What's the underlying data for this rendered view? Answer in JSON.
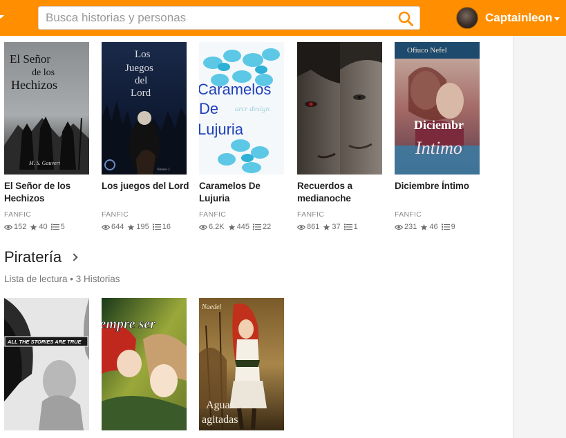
{
  "header": {
    "search_placeholder": "Busca historias y personas",
    "username": "Captainleon"
  },
  "colors": {
    "accent": "#ff8f00"
  },
  "stories": [
    {
      "title": "El Señor de los Hechizos",
      "cover_text": [
        "El Señor",
        "de los",
        "Hechizos"
      ],
      "cover_signature": "M. S. Gauvert",
      "category": "FANFIC",
      "reads": "152",
      "votes": "40",
      "parts": "5"
    },
    {
      "title": "Los juegos del Lord",
      "cover_text": [
        "Los",
        "Juegos",
        "del",
        "Lord"
      ],
      "cover_signature": "Volume 2",
      "category": "FANFIC",
      "reads": "644",
      "votes": "195",
      "parts": "16"
    },
    {
      "title": "Caramelos De Lujuria",
      "cover_text": [
        "Caramelos",
        "De",
        "Lujuria"
      ],
      "cover_watermark": "arcr design",
      "category": "FANFIC",
      "reads": "6.2K",
      "votes": "445",
      "parts": "22"
    },
    {
      "title": "Recuerdos a medianoche",
      "category": "FANFIC",
      "reads": "861",
      "votes": "37",
      "parts": "1"
    },
    {
      "title": "Diciembre Íntimo",
      "cover_text": [
        "Ofiuco Nefel",
        "Diciembr",
        "Intimo"
      ],
      "category": "FANFIC",
      "reads": "231",
      "votes": "46",
      "parts": "9"
    }
  ],
  "reading_list": {
    "title": "Piratería",
    "subtitle": "Lista de lectura • 3 Historias",
    "covers": [
      {
        "cover_text": [
          "ALL THE STORIES ARE TRUE"
        ]
      },
      {
        "cover_text": [
          "iempre ser"
        ]
      },
      {
        "cover_text": [
          "Naedel",
          "Aguas",
          "agitadas"
        ]
      }
    ]
  },
  "icons": {
    "search": "search-icon",
    "reads": "eye-icon",
    "votes": "star-icon",
    "parts": "list-icon"
  }
}
